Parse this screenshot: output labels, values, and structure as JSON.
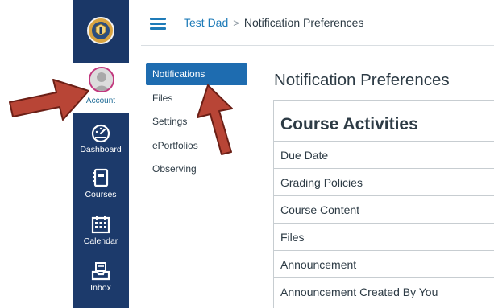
{
  "global_nav": {
    "logo": {
      "icon": "school-seal-logo-icon"
    },
    "account": {
      "label": "Account",
      "icon": "avatar-icon"
    },
    "items": [
      {
        "label": "Dashboard",
        "icon": "dashboard-gauge-icon"
      },
      {
        "label": "Courses",
        "icon": "courses-book-icon"
      },
      {
        "label": "Calendar",
        "icon": "calendar-icon"
      },
      {
        "label": "Inbox",
        "icon": "inbox-icon"
      }
    ]
  },
  "header": {
    "menu_icon": "hamburger-menu-icon",
    "breadcrumb": {
      "parent": "Test Dad",
      "separator": ">",
      "current": "Notification Preferences"
    }
  },
  "sub_nav": {
    "items": [
      {
        "label": "Notifications",
        "active": true
      },
      {
        "label": "Files",
        "active": false
      },
      {
        "label": "Settings",
        "active": false
      },
      {
        "label": "ePortfolios",
        "active": false
      },
      {
        "label": "Observing",
        "active": false
      }
    ]
  },
  "main": {
    "title": "Notification Preferences",
    "section": {
      "heading": "Course Activities",
      "rows": [
        "Due Date",
        "Grading Policies",
        "Course Content",
        "Files",
        "Announcement",
        "Announcement Created By You"
      ]
    }
  },
  "annotations": {
    "arrows": [
      {
        "name": "arrow-pointing-to-account",
        "color": "#b84536"
      },
      {
        "name": "arrow-pointing-to-notifications",
        "color": "#b84536"
      }
    ]
  },
  "colors": {
    "nav_bg": "#1c3a6b",
    "link": "#1e7bb8",
    "active_subnav": "#1e6cb0",
    "avatar_ring": "#c2387e",
    "arrow_fill": "#b84536",
    "arrow_outline": "#6b1f16"
  }
}
